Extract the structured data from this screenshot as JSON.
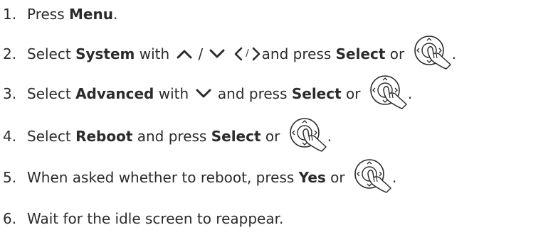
{
  "steps": [
    {
      "number": "1.",
      "parts": [
        "Press ",
        "Menu",
        "."
      ]
    },
    {
      "number": "2.",
      "parts": [
        "Select ",
        "System",
        " with ",
        "/",
        "and press ",
        "Select",
        " or ",
        "."
      ],
      "icons": [
        "chevron-up",
        "chevron-down",
        "chevron-left",
        "chevron-right",
        "nav-key"
      ]
    },
    {
      "number": "3.",
      "parts": [
        "Select ",
        "Advanced",
        " with ",
        " and press ",
        "Select",
        " or ",
        "."
      ],
      "icons": [
        "chevron-down",
        "nav-key"
      ]
    },
    {
      "number": "4.",
      "parts": [
        "Select ",
        "Reboot",
        " and press ",
        "Select",
        " or ",
        "."
      ],
      "icons": [
        "nav-key"
      ]
    },
    {
      "number": "5.",
      "parts": [
        "When asked whether to reboot, press ",
        "Yes",
        " or ",
        "."
      ],
      "icons": [
        "nav-key"
      ]
    },
    {
      "number": "6.",
      "parts": [
        "Wait for the idle screen to reappear."
      ]
    }
  ],
  "colors": {
    "text": "#2b2b2b",
    "background": "#ffffff"
  }
}
